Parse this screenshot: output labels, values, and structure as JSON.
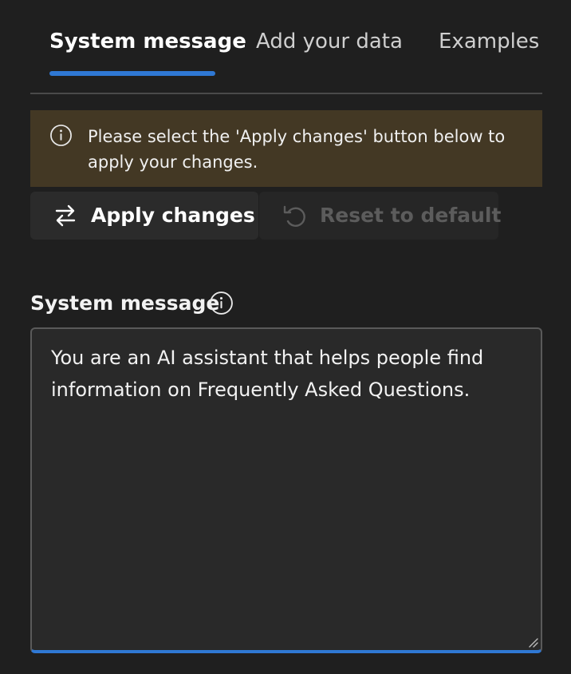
{
  "tabs": [
    {
      "label": "System message",
      "active": true
    },
    {
      "label": "Add your data",
      "active": false
    },
    {
      "label": "Examples",
      "active": false
    }
  ],
  "notice": {
    "icon": "info-icon",
    "text": "Please select the 'Apply changes' button below to apply your changes."
  },
  "actions": {
    "apply_label": "Apply changes",
    "apply_icon": "swap-arrows-icon",
    "reset_label": "Reset to default",
    "reset_icon": "undo-arrow-icon"
  },
  "system_message": {
    "label": "System message",
    "value": "You are an AI assistant that helps people find information on Frequently Asked Questions."
  },
  "colors": {
    "background": "#1f1f1f",
    "accent": "#2f78d4",
    "notice_background": "#433824",
    "button_background": "#2b2b2b"
  }
}
